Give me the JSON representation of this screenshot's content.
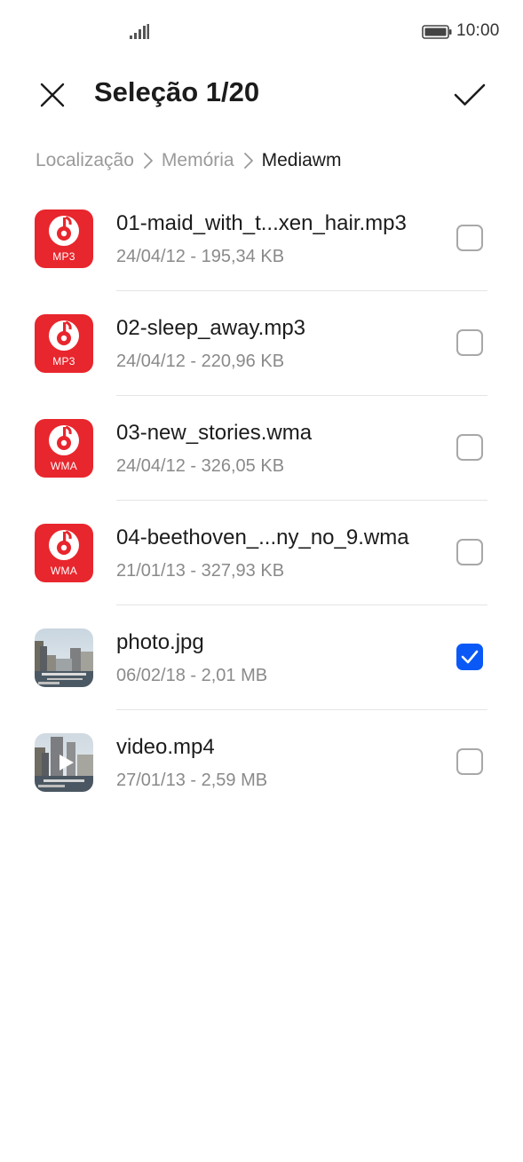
{
  "status_bar": {
    "time": "10:00",
    "signal_icon": "signal-bars-icon",
    "battery_icon": "battery-icon"
  },
  "header": {
    "title": "Seleção 1/20",
    "close_icon": "close-icon",
    "confirm_icon": "checkmark-icon"
  },
  "breadcrumb": {
    "items": [
      "Localização",
      "Memória",
      "Mediawm"
    ]
  },
  "files": [
    {
      "name": "01-maid_with_t...xen_hair.mp3",
      "meta": "24/04/12 - 195,34 KB",
      "type": "audio",
      "ext": "MP3",
      "checked": false
    },
    {
      "name": "02-sleep_away.mp3",
      "meta": "24/04/12 - 220,96 KB",
      "type": "audio",
      "ext": "MP3",
      "checked": false
    },
    {
      "name": "03-new_stories.wma",
      "meta": "24/04/12 - 326,05 KB",
      "type": "audio",
      "ext": "WMA",
      "checked": false
    },
    {
      "name": "04-beethoven_...ny_no_9.wma",
      "meta": "21/01/13 - 327,93 KB",
      "type": "audio",
      "ext": "WMA",
      "checked": false
    },
    {
      "name": "photo.jpg",
      "meta": "06/02/18 - 2,01 MB",
      "type": "image",
      "checked": true
    },
    {
      "name": "video.mp4",
      "meta": "27/01/13 - 2,59 MB",
      "type": "video",
      "checked": false
    }
  ],
  "colors": {
    "accent": "#0a59f7",
    "audio_icon_bg": "#e8262d"
  }
}
